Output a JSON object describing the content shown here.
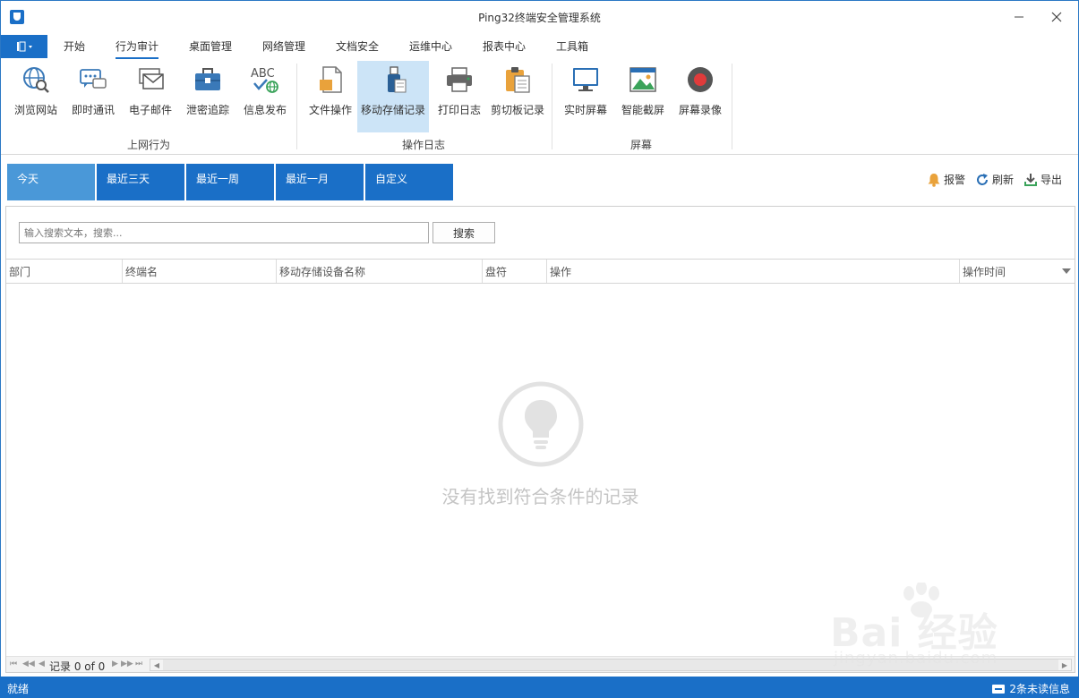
{
  "window": {
    "title": "Ping32终端安全管理系统"
  },
  "ribbon_tabs": [
    "开始",
    "行为审计",
    "桌面管理",
    "网络管理",
    "文档安全",
    "运维中心",
    "报表中心",
    "工具箱"
  ],
  "ribbon_active_tab": "行为审计",
  "ribbon": {
    "groups": [
      {
        "label": "上网行为",
        "buttons": [
          "浏览网站",
          "即时通讯",
          "电子邮件",
          "泄密追踪",
          "信息发布"
        ]
      },
      {
        "label": "操作日志",
        "buttons": [
          "文件操作",
          "移动存储记录",
          "打印日志",
          "剪切板记录"
        ]
      },
      {
        "label": "屏幕",
        "buttons": [
          "实时屏幕",
          "智能截屏",
          "屏幕录像"
        ]
      }
    ],
    "active_button": "移动存储记录",
    "icon_text_abc": "ABC"
  },
  "date_tabs": [
    "今天",
    "最近三天",
    "最近一周",
    "最近一月",
    "自定义"
  ],
  "date_active": "今天",
  "actions": {
    "alarm": "报警",
    "refresh": "刷新",
    "export": "导出"
  },
  "search": {
    "placeholder": "输入搜索文本，搜索...",
    "button": "搜索"
  },
  "grid": {
    "columns": [
      "部门",
      "终端名",
      "移动存储设备名称",
      "盘符",
      "操作",
      "操作时间"
    ],
    "empty_text": "没有找到符合条件的记录",
    "record_text": "记录 0 of 0"
  },
  "status": {
    "left": "就绪",
    "right": "2条未读信息"
  },
  "watermark": {
    "brand": "Bai 经验",
    "sub": "jingyan.baidu.com"
  },
  "colors": {
    "accent": "#1a6fc7",
    "tab_active": "#4a98d8",
    "button_active": "#cce4f7"
  }
}
